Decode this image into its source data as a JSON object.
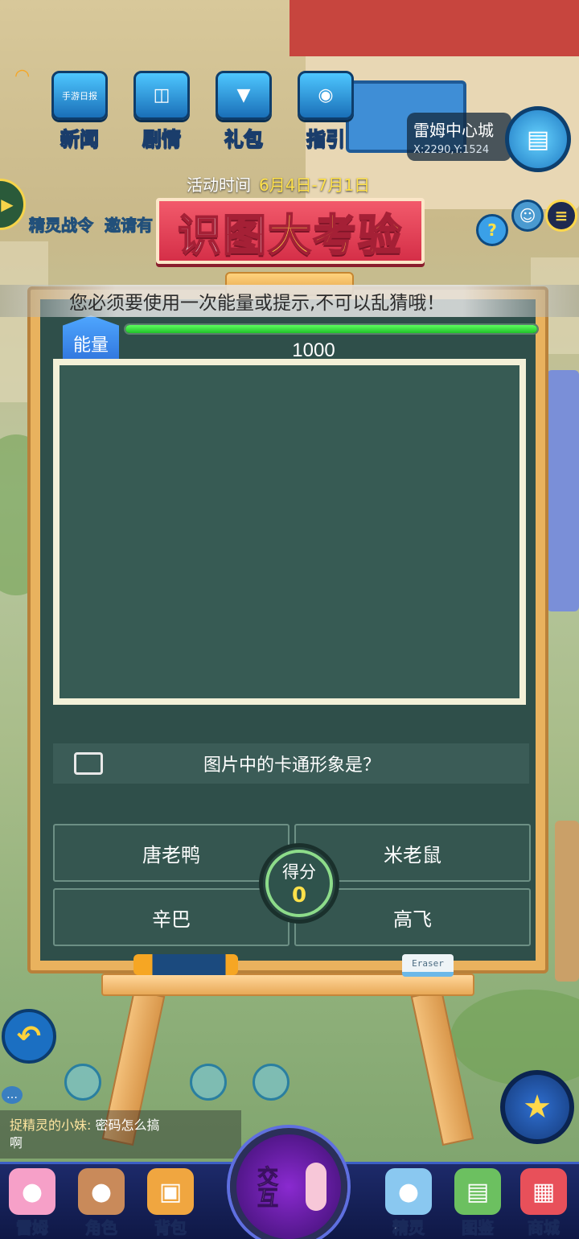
{
  "top_menu": [
    {
      "label": "新闻",
      "icon": "newspaper-tv-icon",
      "badge": "手游日报"
    },
    {
      "label": "剧情",
      "icon": "story-machine-icon"
    },
    {
      "label": "礼包",
      "icon": "gift-chest-icon"
    },
    {
      "label": "指引",
      "icon": "guide-machine-icon"
    }
  ],
  "location": {
    "name": "雷姆中心城",
    "coord": "X:2290,Y:1524"
  },
  "side_labels": {
    "spirit_pass": "精灵战令",
    "invite": "邀请有"
  },
  "activity": {
    "time_label": "活动时间",
    "dates": "6月4日-7月1日",
    "title_part1": "识图",
    "title_part2": "大考验"
  },
  "energy": {
    "label": "能量",
    "value": "1000",
    "fill_fraction": 1.0
  },
  "hint": "您必须要使用一次能量或提示,不可以乱猜哦！",
  "question": "图片中的卡通形象是？",
  "answers": [
    "唐老鸭",
    "米老鼠",
    "辛巴",
    "高飞"
  ],
  "score": {
    "label": "得分",
    "value": "0"
  },
  "eraser_label": "Eraser",
  "chat": {
    "sender": "捉精灵的小妹:",
    "message": "密码怎么搞",
    "message_line2": "啊"
  },
  "center_button": {
    "label": "交互"
  },
  "bottom_nav": [
    {
      "label": "雷姆",
      "icon": "pink-pet-icon",
      "color": "#f6a0c8"
    },
    {
      "label": "角色",
      "icon": "boy-avatar-icon",
      "color": "#c98a5a"
    },
    {
      "label": "背包",
      "icon": "backpack-icon",
      "color": "#f0a640"
    },
    {
      "label": "精灵",
      "icon": "blue-spirit-icon",
      "color": "#8ac8f0"
    },
    {
      "label": "图鉴",
      "icon": "green-book-icon",
      "color": "#6cc060"
    },
    {
      "label": "商城",
      "icon": "shop-icon",
      "color": "#e8505a"
    }
  ],
  "colors": {
    "board": "#2f4f4a",
    "frame": "#e9b25e",
    "energy": "#20c12a",
    "score": "#ffe14a",
    "banner": "#d52f48"
  }
}
